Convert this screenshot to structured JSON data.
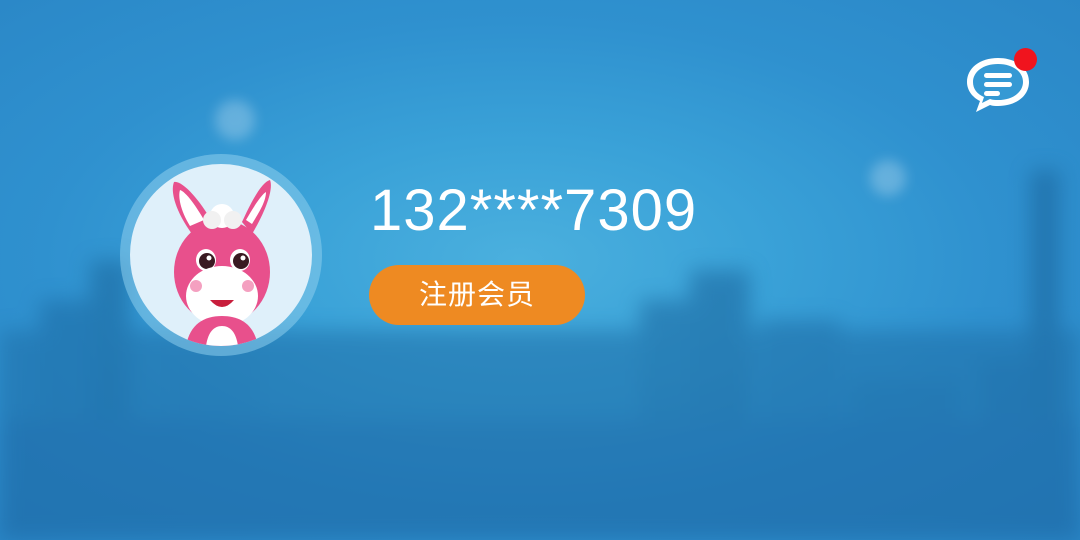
{
  "profile": {
    "phone_masked": "132****7309",
    "register_label": "注册会员",
    "avatar_icon": "pink-donkey-avatar-icon"
  },
  "header": {
    "message_icon": "chat-bubble-icon",
    "has_unread": true
  },
  "colors": {
    "background": "#3aa2d8",
    "register_button": "#ee8a22",
    "badge": "#f0141e",
    "text": "#ffffff"
  }
}
